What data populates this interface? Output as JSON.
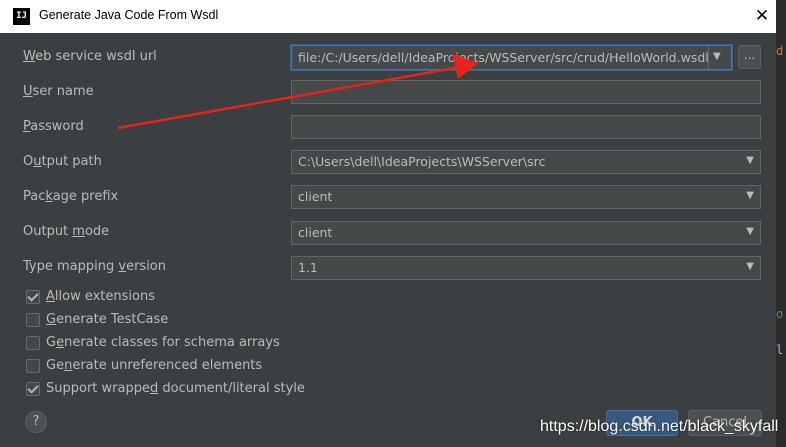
{
  "window": {
    "title": "Generate Java Code From Wsdl",
    "app_icon_text": "IJ",
    "close_symbol": "✕"
  },
  "form": {
    "wsdl_url": {
      "label_mn": "W",
      "label_rest": "eb service wsdl url",
      "value": "file:/C:/Users/dell/IdeaProjects/WSServer/src/crud/HelloWorld.wsdl",
      "browse_label": "..."
    },
    "user_name": {
      "label_mn": "U",
      "label_rest": "ser name",
      "value": ""
    },
    "password": {
      "label_mn": "P",
      "label_rest": "assword",
      "value": ""
    },
    "output_path": {
      "label_pre": "O",
      "label_mn": "u",
      "label_rest": "tput path",
      "value": "C:\\Users\\dell\\IdeaProjects\\WSServer\\src"
    },
    "package_prefix": {
      "label_pre": "Pac",
      "label_mn": "k",
      "label_rest": "age prefix",
      "value": "client"
    },
    "output_mode": {
      "label_pre": "Output ",
      "label_mn": "m",
      "label_rest": "ode",
      "value": "client"
    },
    "type_mapping_version": {
      "label_pre": "Type mapping ",
      "label_mn": "v",
      "label_rest": "ersion",
      "value": "1.1"
    }
  },
  "checkboxes": [
    {
      "pre": "",
      "mn": "A",
      "rest": "llow extensions",
      "checked": true
    },
    {
      "pre": "",
      "mn": "G",
      "rest": "enerate TestCase",
      "checked": false
    },
    {
      "pre": "G",
      "mn": "e",
      "rest": "nerate classes for schema arrays",
      "checked": false
    },
    {
      "pre": "Ge",
      "mn": "n",
      "rest": "erate unreferenced elements",
      "checked": false
    },
    {
      "pre": "Support wrappe",
      "mn": "d",
      "rest": " document/literal style",
      "checked": true
    }
  ],
  "buttons": {
    "help": "?",
    "ok": "OK",
    "cancel": "Cancel"
  },
  "watermark": "https://blog.csdn.net/black_skyfall",
  "colors": {
    "dialog_bg": "#3c3f41",
    "field_bg": "#45494a",
    "accent_blue": "#365880",
    "annotation_red": "#e8231a"
  }
}
